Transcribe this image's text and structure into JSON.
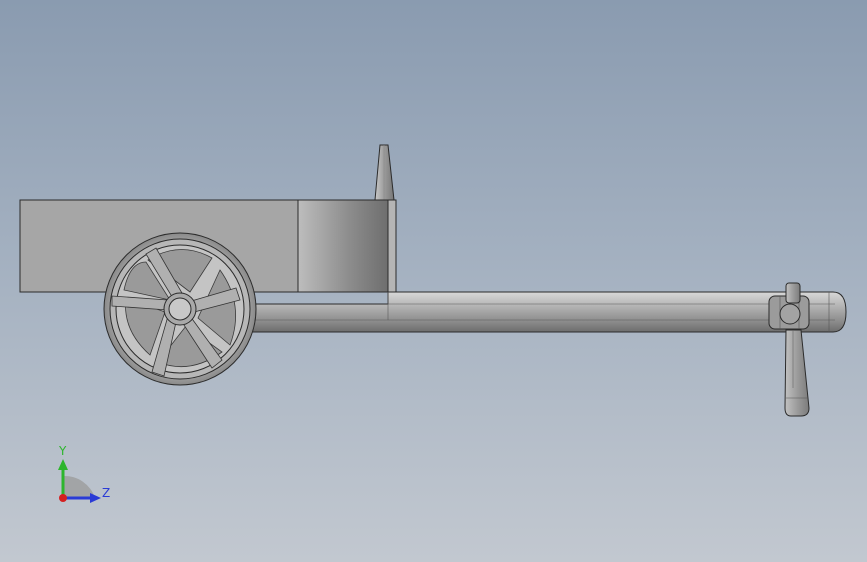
{
  "triad": {
    "y_label": "Y",
    "z_label": "Z",
    "y_color": "#2db52d",
    "z_color": "#2a3bd6",
    "x_color": "#d42020"
  },
  "model": {
    "body_color": "#a6a6a6",
    "edge_color": "#2b2b2b"
  }
}
